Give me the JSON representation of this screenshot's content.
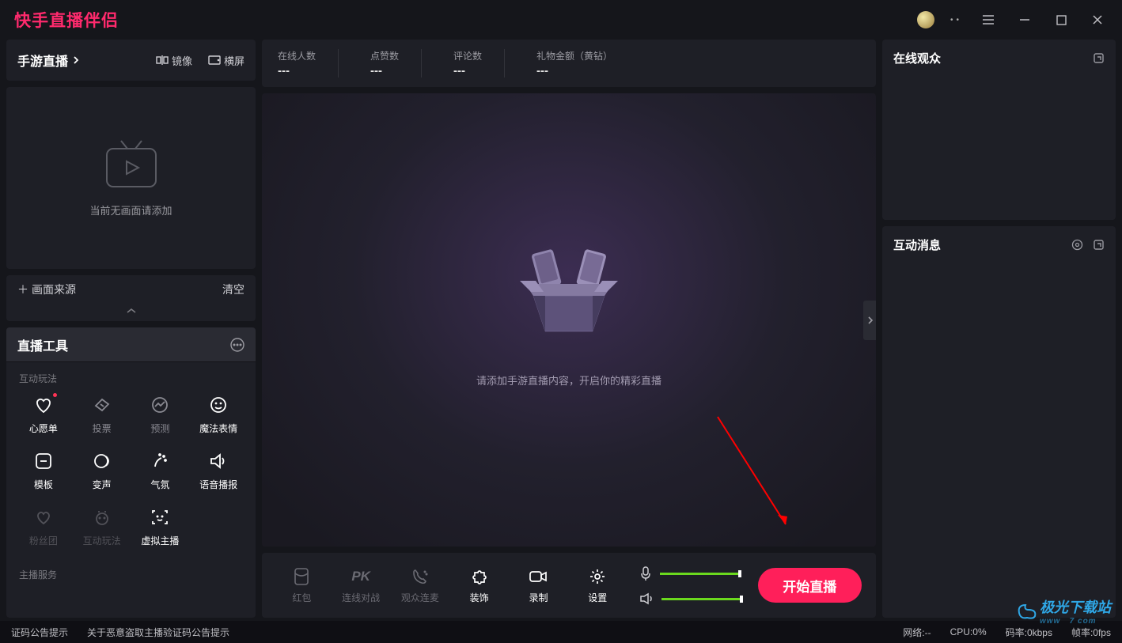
{
  "app": {
    "title": "快手直播伴侣"
  },
  "mode_bar": {
    "main": "手游直播",
    "mirror": "镜像",
    "landscape": "横屏"
  },
  "preview_empty": "当前无画面请添加",
  "source_bar": {
    "add": "画面来源",
    "clear": "清空"
  },
  "tools": {
    "title": "直播工具",
    "play_section": "互动玩法",
    "service_section": "主播服务",
    "items": [
      {
        "label": "心愿单"
      },
      {
        "label": "投票"
      },
      {
        "label": "预测"
      },
      {
        "label": "魔法表情"
      },
      {
        "label": "模板"
      },
      {
        "label": "变声"
      },
      {
        "label": "气氛"
      },
      {
        "label": "语音播报"
      },
      {
        "label": "粉丝团"
      },
      {
        "label": "互动玩法"
      },
      {
        "label": "虚拟主播"
      }
    ]
  },
  "stats": [
    {
      "label": "在线人数",
      "value": "---"
    },
    {
      "label": "点赞数",
      "value": "---"
    },
    {
      "label": "评论数",
      "value": "---"
    },
    {
      "label": "礼物金额（黄钻）",
      "value": "---"
    }
  ],
  "center_hint": "请添加手游直播内容，开启你的精彩直播",
  "controls": [
    {
      "label": "红包"
    },
    {
      "label": "连线对战"
    },
    {
      "label": "观众连麦"
    },
    {
      "label": "装饰"
    },
    {
      "label": "录制"
    },
    {
      "label": "设置"
    }
  ],
  "start_button": "开始直播",
  "right": {
    "audience": "在线观众",
    "messages": "互动消息"
  },
  "status": {
    "notice1": "证码公告提示",
    "notice2": "关于恶意盗取主播验证码公告提示",
    "net": "网络:--",
    "cpu": "CPU:0%",
    "bitrate": "码率:0kbps",
    "fps": "帧率:0fps"
  },
  "watermark": "极光下载站"
}
